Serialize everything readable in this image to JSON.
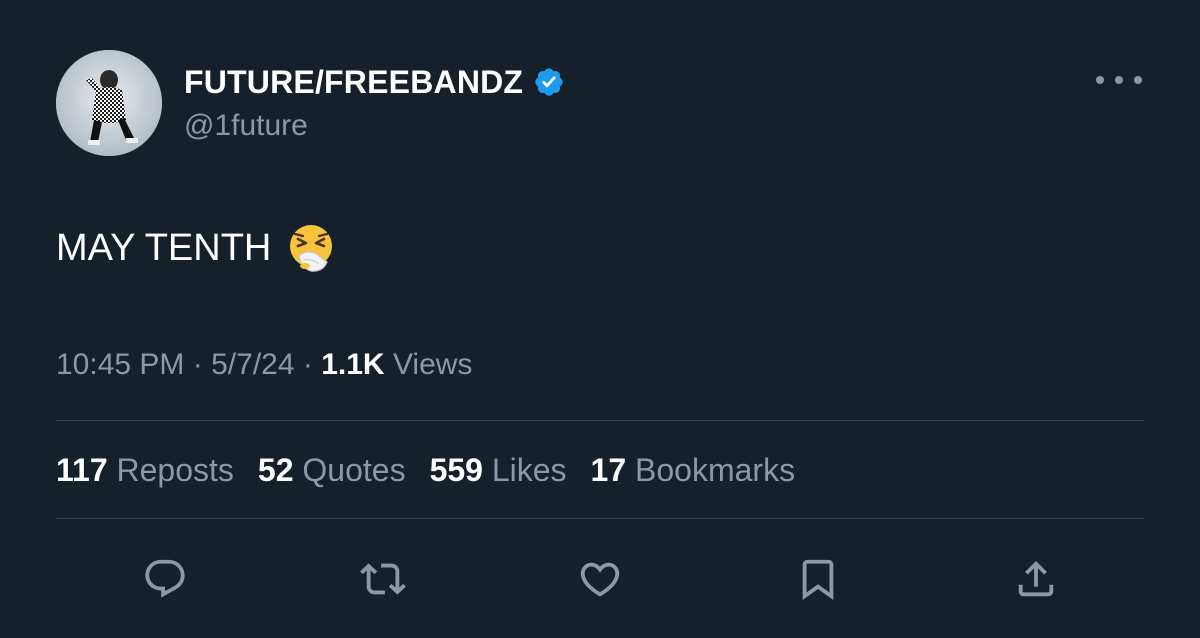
{
  "author": {
    "display_name": "FUTURE/FREEBANDZ",
    "handle": "@1future",
    "verified": true
  },
  "tweet": {
    "text": "MAY TENTH",
    "emoji": "sneezing-face"
  },
  "meta": {
    "time": "10:45 PM",
    "separator": "·",
    "date": "5/7/24",
    "views_count": "1.1K",
    "views_label": "Views"
  },
  "stats": [
    {
      "count": "117",
      "label": "Reposts"
    },
    {
      "count": "52",
      "label": "Quotes"
    },
    {
      "count": "559",
      "label": "Likes"
    },
    {
      "count": "17",
      "label": "Bookmarks"
    }
  ],
  "actions": [
    "reply-icon",
    "repost-icon",
    "like-icon",
    "bookmark-icon",
    "share-icon"
  ],
  "colors": {
    "background": "#15202b",
    "primary_text": "#ffffff",
    "secondary_text": "#8b98a5",
    "divider": "#38444d",
    "verified": "#1d9bf0"
  }
}
